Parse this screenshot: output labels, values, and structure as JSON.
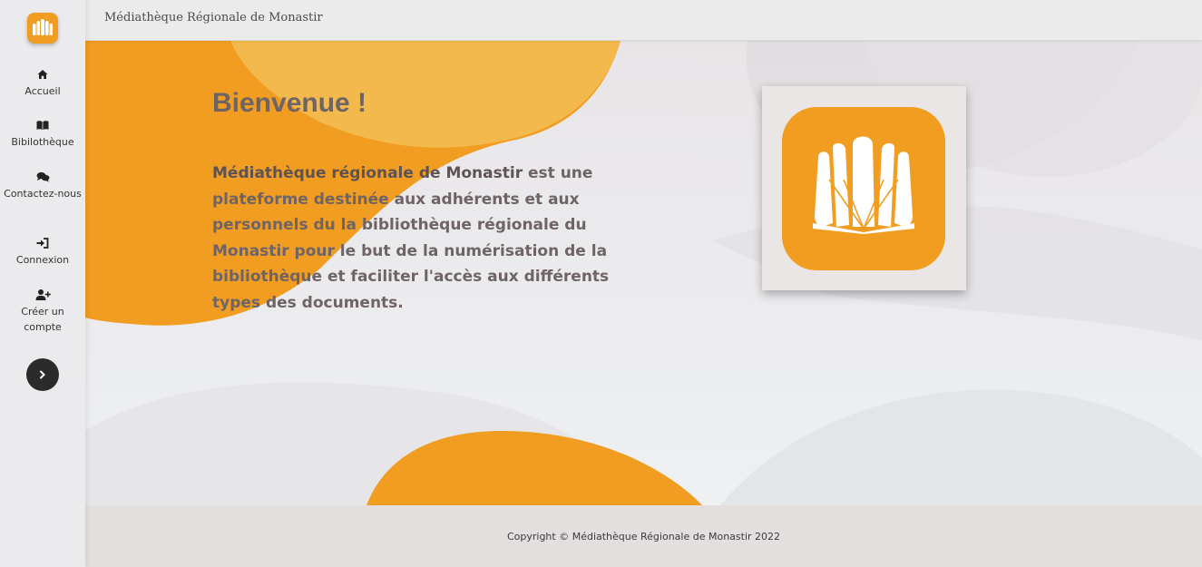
{
  "app": {
    "title": "Médiathèque Régionale de Monastir",
    "brand_color": "#f09d22",
    "logo_icon": "open-book-icon"
  },
  "sidebar": {
    "items": [
      {
        "label": "Accueil",
        "icon": "home-icon"
      },
      {
        "label": "Bibilothèque",
        "icon": "book-icon"
      },
      {
        "label": "Contactez-nous",
        "icon": "comments-icon"
      },
      {
        "label": "Connexion",
        "icon": "sign-in-icon"
      },
      {
        "label": "Créer un compte",
        "icon": "user-plus-icon"
      }
    ],
    "expand_icon": "chevron-right-icon"
  },
  "main": {
    "heading": "Bienvenue !",
    "intro_strong": "Médiathèque régionale de Monastir",
    "intro_text": " est une plateforme destinée aux adhérents et aux personnels du la bibliothèque régionale du Monastir pour le but de la numérisation de la bibliothèque et faciliter l'accès aux différents types des documents."
  },
  "footer": {
    "copyright": "Copyright © Médiathèque Régionale de Monastir 2022"
  }
}
